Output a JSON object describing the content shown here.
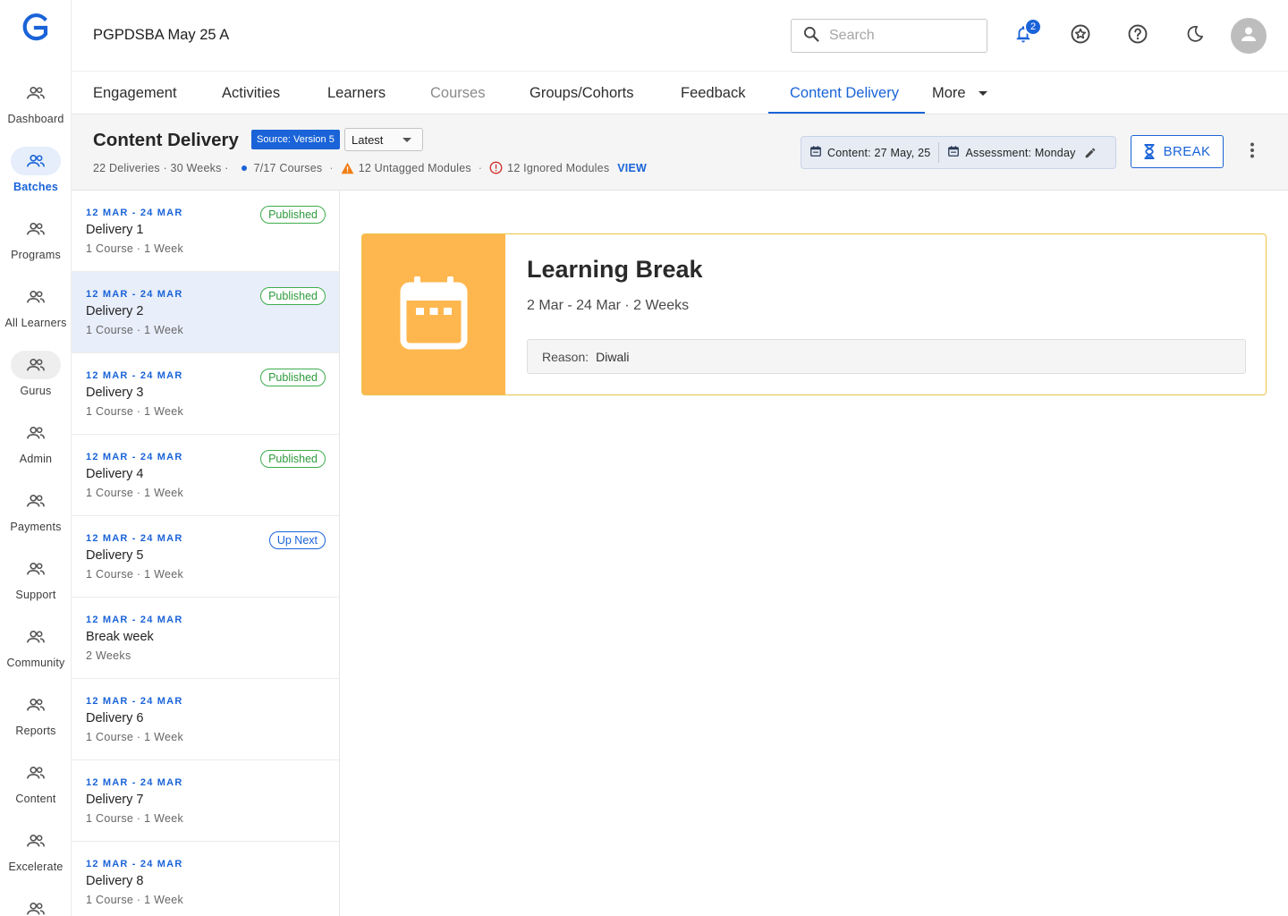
{
  "app": {
    "batch_title": "PGPDSBA May 25 A",
    "notification_count": "2",
    "accent_color": "#1a63d8"
  },
  "search": {
    "placeholder": "Search"
  },
  "rail": {
    "items": [
      {
        "label": "Dashboard",
        "icon": "people-icon"
      },
      {
        "label": "Batches",
        "icon": "people-icon",
        "active": true
      },
      {
        "label": "Programs",
        "icon": "people-icon"
      },
      {
        "label": "All Learners",
        "icon": "people-icon"
      },
      {
        "label": "Gurus",
        "icon": "people-icon"
      },
      {
        "label": "Admin",
        "icon": "people-icon"
      },
      {
        "label": "Payments",
        "icon": "people-icon"
      },
      {
        "label": "Support",
        "icon": "people-icon"
      },
      {
        "label": "Community",
        "icon": "people-icon"
      },
      {
        "label": "Reports",
        "icon": "people-icon"
      },
      {
        "label": "Content",
        "icon": "people-icon"
      },
      {
        "label": "Excelerate",
        "icon": "people-icon"
      }
    ]
  },
  "tabs": [
    {
      "label": "Engagement"
    },
    {
      "label": "Activities"
    },
    {
      "label": "Learners"
    },
    {
      "label": "Courses",
      "muted": true
    },
    {
      "label": "Groups/Cohorts"
    },
    {
      "label": "Feedback"
    },
    {
      "label": "Content Delivery",
      "active": true
    },
    {
      "label": "More"
    }
  ],
  "header": {
    "title": "Content Delivery",
    "source_chip": "Source: Version 5",
    "version_select": "Latest",
    "deliveries": "22 Deliveries · 30 Weeks ·",
    "courses": "7/17 Courses",
    "untagged": "12 Untagged Modules",
    "ignored": "12 Ignored Modules",
    "view_link": "VIEW",
    "content_date": "Content: 27 May, 25",
    "assessment_day": "Assessment: Monday",
    "break_button": "BREAK"
  },
  "deliveries": [
    {
      "date": "12 MAR - 24 MAR",
      "name": "Delivery 1",
      "sub": "1 Course · 1 Week",
      "status": "Published"
    },
    {
      "date": "12 MAR - 24 MAR",
      "name": "Delivery 2",
      "sub": "1 Course · 1 Week",
      "status": "Published",
      "selected": true
    },
    {
      "date": "12 MAR - 24 MAR",
      "name": "Delivery 3",
      "sub": "1 Course · 1 Week",
      "status": "Published"
    },
    {
      "date": "12 MAR - 24 MAR",
      "name": "Delivery 4",
      "sub": "1 Course · 1 Week",
      "status": "Published"
    },
    {
      "date": "12 MAR - 24 MAR",
      "name": "Delivery 5",
      "sub": "1 Course · 1 Week",
      "status": "Up Next"
    },
    {
      "date": "12 MAR - 24 MAR",
      "name": "Break week",
      "sub": "2 Weeks",
      "status": ""
    },
    {
      "date": "12 MAR - 24 MAR",
      "name": "Delivery 6",
      "sub": "1 Course · 1 Week",
      "status": ""
    },
    {
      "date": "12 MAR - 24 MAR",
      "name": "Delivery 7",
      "sub": "1 Course · 1 Week",
      "status": ""
    },
    {
      "date": "12 MAR - 24 MAR",
      "name": "Delivery 8",
      "sub": "1 Course · 1 Week",
      "status": ""
    }
  ],
  "break_card": {
    "title": "Learning Break",
    "subtitle": "2 Mar - 24 Mar · 2 Weeks",
    "reason_label": "Reason:",
    "reason_value": "Diwali",
    "accent_color": "#feb74e"
  }
}
